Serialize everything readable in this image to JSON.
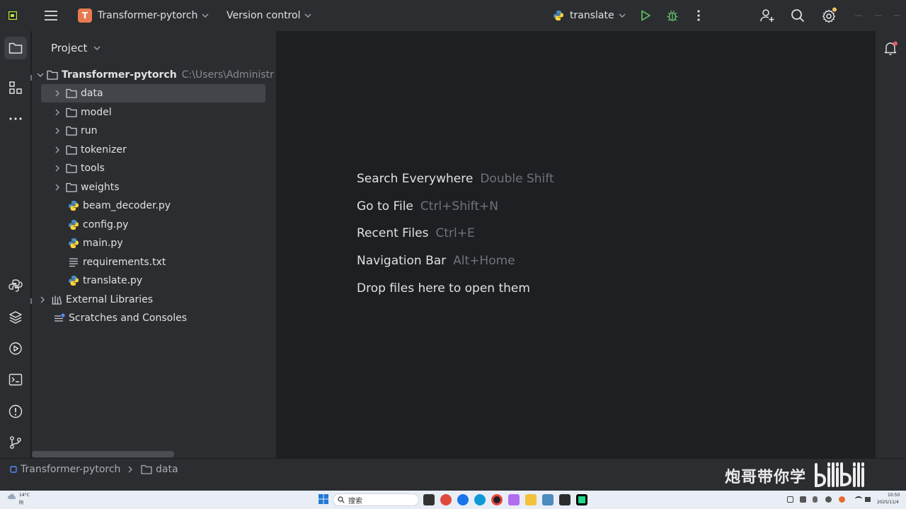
{
  "titlebar": {
    "project_badge": "T",
    "project_name": "Transformer-pytorch",
    "version_control": "Version control",
    "run_config": "translate"
  },
  "project_panel": {
    "title": "Project",
    "root": {
      "name": "Transformer-pytorch",
      "path": "C:\\Users\\Administra"
    },
    "items": [
      {
        "label": "data",
        "type": "folder"
      },
      {
        "label": "model",
        "type": "folder"
      },
      {
        "label": "run",
        "type": "folder"
      },
      {
        "label": "tokenizer",
        "type": "folder"
      },
      {
        "label": "tools",
        "type": "folder"
      },
      {
        "label": "weights",
        "type": "folder"
      },
      {
        "label": "beam_decoder.py",
        "type": "python"
      },
      {
        "label": "config.py",
        "type": "python"
      },
      {
        "label": "main.py",
        "type": "python"
      },
      {
        "label": "requirements.txt",
        "type": "text"
      },
      {
        "label": "translate.py",
        "type": "python"
      }
    ],
    "external_libraries": "External Libraries",
    "scratches": "Scratches and Consoles"
  },
  "editor_hints": [
    {
      "action": "Search Everywhere",
      "shortcut": "Double Shift"
    },
    {
      "action": "Go to File",
      "shortcut": "Ctrl+Shift+N"
    },
    {
      "action": "Recent Files",
      "shortcut": "Ctrl+E"
    },
    {
      "action": "Navigation Bar",
      "shortcut": "Alt+Home"
    },
    {
      "action": "Drop files here to open them",
      "shortcut": ""
    }
  ],
  "breadcrumb": {
    "project": "Transformer-pytorch",
    "folder": "data"
  },
  "watermark": {
    "text": "炮哥带你学",
    "logo": "bilibili"
  },
  "taskbar": {
    "weather_temp": "14°C",
    "weather_desc": "阴",
    "search_placeholder": "搜索",
    "time": "10:50",
    "date": "2025/11/4"
  },
  "colors": {
    "accent_run": "#5fb865",
    "project_badge": "#e87a52",
    "selection": "#43454a",
    "notification_dot": "#e55765",
    "settings_dot": "#f2c55c"
  }
}
